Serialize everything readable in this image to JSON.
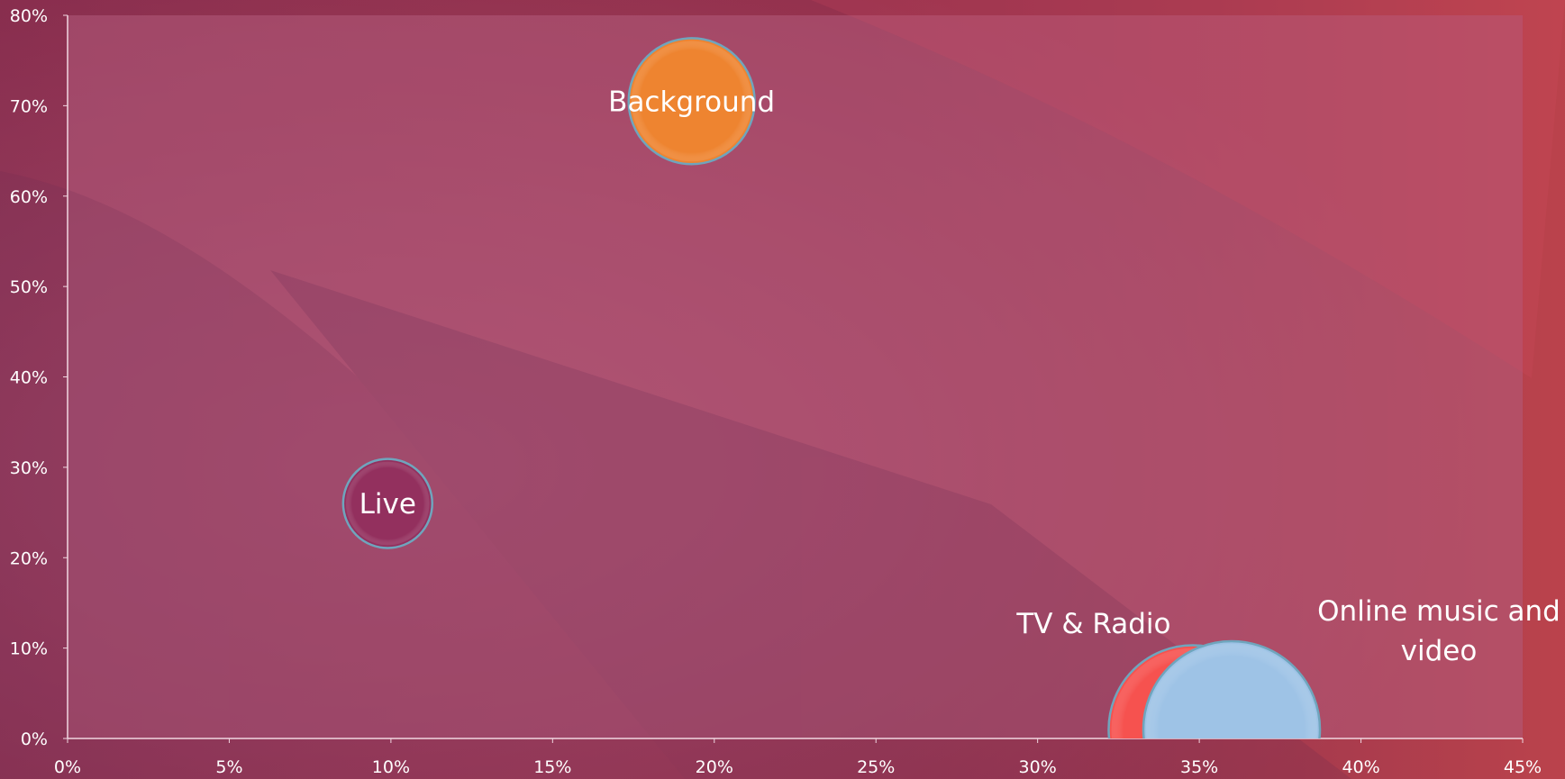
{
  "chart_data": {
    "type": "bubble",
    "title": "",
    "xlabel": "",
    "ylabel": "",
    "xlim": [
      0,
      0.45
    ],
    "ylim": [
      0,
      0.8
    ],
    "x_ticks": [
      "0%",
      "5%",
      "10%",
      "15%",
      "20%",
      "25%",
      "30%",
      "35%",
      "40%",
      "45%"
    ],
    "y_ticks": [
      "0%",
      "10%",
      "20%",
      "30%",
      "40%",
      "50%",
      "60%",
      "70%",
      "80%"
    ],
    "grid": false,
    "legend": "none",
    "series": [
      {
        "name": "Background",
        "label_lines": [
          "Background"
        ],
        "x": 0.193,
        "y": 0.705,
        "size": 0.28,
        "color": "#ee8430"
      },
      {
        "name": "Live",
        "label_lines": [
          "Live"
        ],
        "x": 0.099,
        "y": 0.26,
        "size": 0.14,
        "color": "#93305e"
      },
      {
        "name": "TV & Radio",
        "label_lines": [
          "TV & Radio"
        ],
        "x": 0.348,
        "y": 0.01,
        "size": 0.5,
        "color": "#f6524f"
      },
      {
        "name": "Online music and video",
        "label_lines": [
          "Online music and",
          "video"
        ],
        "x": 0.36,
        "y": 0.01,
        "size": 0.55,
        "color": "#9ec3e6"
      }
    ]
  },
  "colors": {
    "background": "#9e3450",
    "plot_area": "#b35b7c",
    "axis_line": "#f1d7e1",
    "bubble_border": "#6fa5bd"
  }
}
